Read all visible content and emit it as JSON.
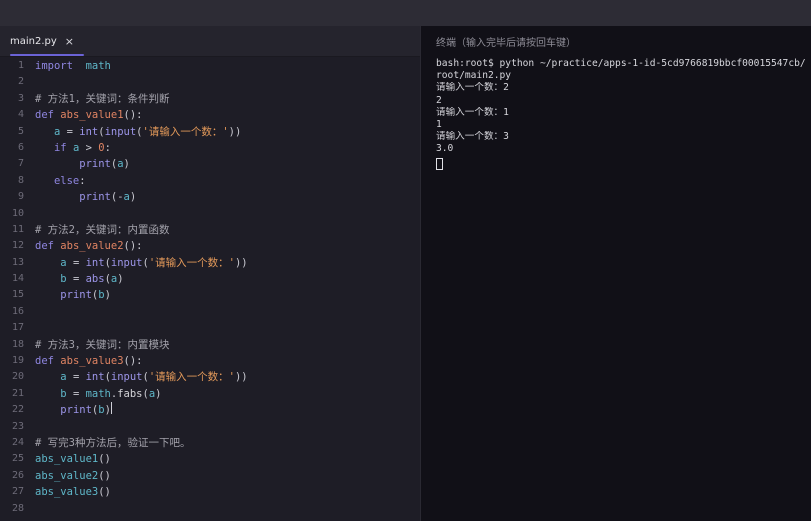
{
  "editor": {
    "tab": {
      "filename": "main2.py",
      "close_icon": "×"
    },
    "lines": [
      {
        "n": "1"
      },
      {
        "n": "2"
      },
      {
        "n": "3"
      },
      {
        "n": "4"
      },
      {
        "n": "5"
      },
      {
        "n": "6"
      },
      {
        "n": "7"
      },
      {
        "n": "8"
      },
      {
        "n": "9"
      },
      {
        "n": "10"
      },
      {
        "n": "11"
      },
      {
        "n": "12"
      },
      {
        "n": "13"
      },
      {
        "n": "14"
      },
      {
        "n": "15"
      },
      {
        "n": "16"
      },
      {
        "n": "17"
      },
      {
        "n": "18"
      },
      {
        "n": "19"
      },
      {
        "n": "20"
      },
      {
        "n": "21"
      },
      {
        "n": "22"
      },
      {
        "n": "23"
      },
      {
        "n": "24"
      },
      {
        "n": "25"
      },
      {
        "n": "26"
      },
      {
        "n": "27"
      },
      {
        "n": "28"
      }
    ],
    "tokens": {
      "import": "import",
      "math": "math",
      "def": "def",
      "if": "if",
      "else": "else",
      "int": "int",
      "input": "input",
      "print": "print",
      "abs": "abs",
      "fabs": "fabs",
      "a": "a",
      "b": "b",
      "zero": "0",
      "prompt": "'请输入一个数：'",
      "c1": "# 方法1，关键词：条件判断",
      "c2": "# 方法2，关键词：内置函数",
      "c3": "# 方法3，关键词：内置模块",
      "c4": "# 写完3种方法后，验证一下吧。",
      "f1": "abs_value1",
      "f2": "abs_value2",
      "f3": "abs_value3"
    }
  },
  "terminal": {
    "title": "终端（输入完毕后请按回车键）",
    "lines": [
      "bash:root$ python ~/practice/apps-1-id-5cd9766819bbcf00015547cb/",
      "root/main2.py",
      "请输入一个数：2",
      "2",
      "请输入一个数：1",
      "1",
      "请输入一个数：3",
      "3.0"
    ]
  }
}
